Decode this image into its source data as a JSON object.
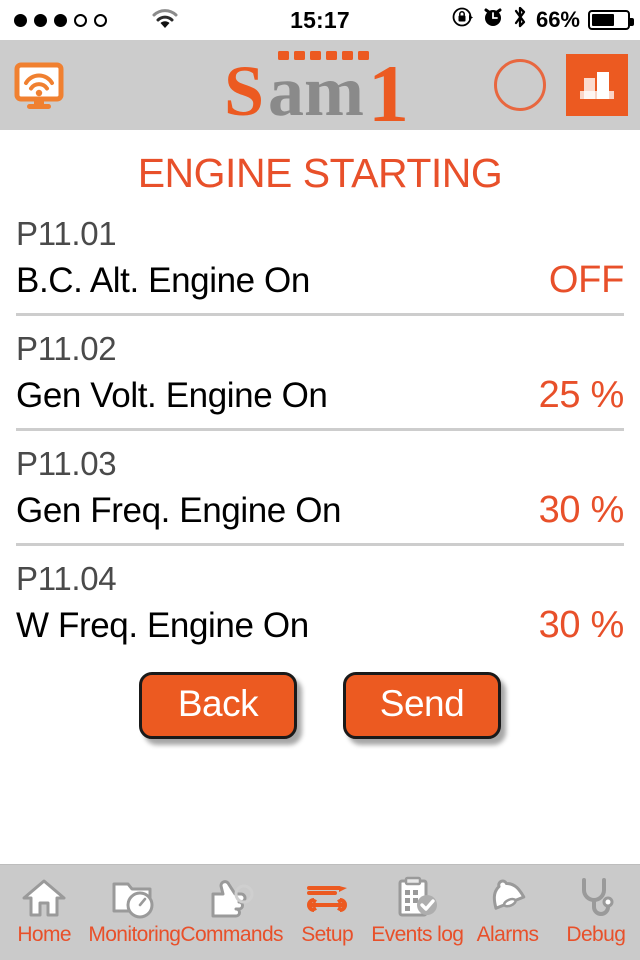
{
  "statusbar": {
    "signal_dots_filled": 3,
    "signal_dots_total": 5,
    "wifi_icon": "wifi-icon",
    "time": "15:17",
    "rotation_lock_icon": "rotation-lock-icon",
    "alarm_icon": "alarm-clock-icon",
    "bluetooth_icon": "bluetooth-icon",
    "battery_percent": "66%",
    "battery_level": 66
  },
  "header": {
    "connection_icon": "monitor-wifi-icon",
    "logo": {
      "part1": "S",
      "part2": "am",
      "part3": "1",
      "full": "Sam1"
    },
    "status_circle_icon": "status-circle-icon",
    "chart_button_icon": "bar-chart-icon"
  },
  "page": {
    "title": "ENGINE STARTING"
  },
  "parameters": [
    {
      "code": "P11.01",
      "label": "B.C. Alt. Engine On",
      "value": "OFF"
    },
    {
      "code": "P11.02",
      "label": "Gen Volt. Engine On",
      "value": "25 %"
    },
    {
      "code": "P11.03",
      "label": "Gen Freq. Engine On",
      "value": "30 %"
    },
    {
      "code": "P11.04",
      "label": "W Freq. Engine On",
      "value": "30 %"
    }
  ],
  "actions": {
    "back_label": "Back",
    "send_label": "Send"
  },
  "tabs": [
    {
      "label": "Home",
      "icon": "home-icon",
      "active": false
    },
    {
      "label": "Monitoring",
      "icon": "folder-gauge-icon",
      "active": false
    },
    {
      "label": "Commands",
      "icon": "hand-pointer-icon",
      "active": false
    },
    {
      "label": "Setup",
      "icon": "tools-icon",
      "active": true
    },
    {
      "label": "Events log",
      "icon": "clipboard-check-icon",
      "active": false
    },
    {
      "label": "Alarms",
      "icon": "bell-icon",
      "active": false
    },
    {
      "label": "Debug",
      "icon": "stethoscope-icon",
      "active": false
    }
  ],
  "colors": {
    "accent_orange": "#E8502A",
    "button_orange": "#EC5A21",
    "header_gray": "#CCCCCC",
    "tabbar_gray": "#CACACA",
    "code_gray": "#4A4A4A",
    "separator": "#CDCDCD"
  }
}
